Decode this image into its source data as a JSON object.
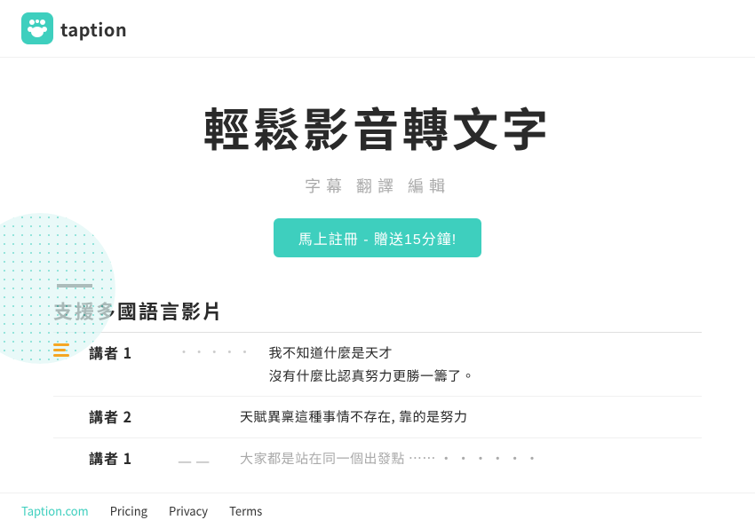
{
  "navbar": {
    "logo_text": "taption",
    "logo_icon_label": "taption-logo-icon"
  },
  "hero": {
    "title": "輕鬆影音轉文字",
    "subtitle": "字幕 翻譯 編輯",
    "cta_label": "馬上註冊 - 贈送15分鐘!"
  },
  "feature": {
    "section_title": "支援多國語言影片",
    "divider_visible": true
  },
  "transcript": {
    "rows": [
      {
        "has_icon": true,
        "speaker": "講者 1",
        "dots": "· · · · ·",
        "lines": [
          "我不知道什麼是天才",
          "沒有什麼比認真努力更勝一籌了。"
        ]
      },
      {
        "has_icon": false,
        "speaker": "講者 2",
        "dots": "",
        "lines": [
          "天賦異稟這種事情不存在, 靠的是努力"
        ]
      },
      {
        "has_icon": false,
        "speaker": "講者 1",
        "dots": "— —",
        "lines": [
          "大家都是站在同一個出發點 ……"
        ],
        "partial": true
      }
    ]
  },
  "footer": {
    "links": [
      {
        "label": "Taption.com",
        "style": "accent"
      },
      {
        "label": "Pricing",
        "style": "accent"
      },
      {
        "label": "Privacy",
        "style": "accent"
      },
      {
        "label": "Terms",
        "style": "accent"
      }
    ]
  }
}
